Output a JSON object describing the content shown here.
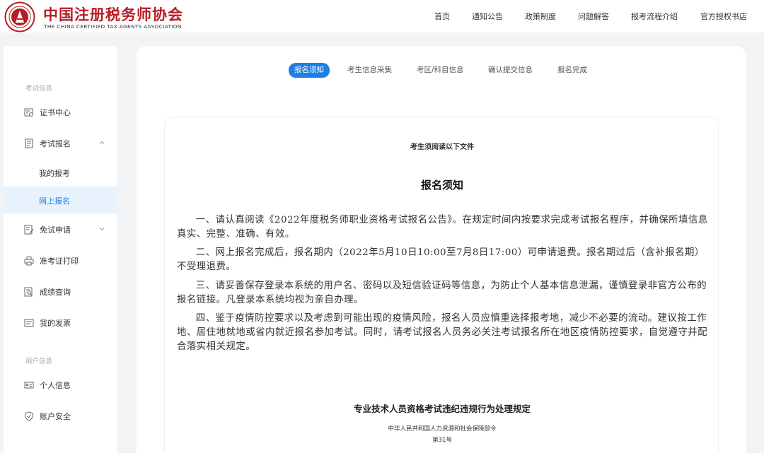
{
  "header": {
    "brand_cn": "中国注册税务师协会",
    "brand_en": "THE CHINA CERTIFIED TAX AGENTS ASSOCIATION",
    "logo_icon": "association-seal-icon",
    "brand_color": "#b71c23",
    "nav": [
      "首页",
      "通知公告",
      "政策制度",
      "问题解答",
      "报考流程介绍",
      "官方授权书店"
    ]
  },
  "sidebar": {
    "section1": "考试信息",
    "items": [
      {
        "label": "证书中心",
        "icon": "certificate-icon"
      },
      {
        "label": "考试报名",
        "icon": "document-icon"
      },
      {
        "label": "我的报考"
      },
      {
        "label": "网上报名"
      },
      {
        "label": "免试申请",
        "icon": "edit-document-icon"
      },
      {
        "label": "准考证打印",
        "icon": "printer-icon"
      },
      {
        "label": "成绩查询",
        "icon": "search-document-icon"
      },
      {
        "label": "我的发票",
        "icon": "invoice-icon"
      }
    ],
    "section2": "用户信息",
    "user_items": [
      {
        "label": "个人信息",
        "icon": "id-card-icon"
      },
      {
        "label": "账户安全",
        "icon": "shield-icon"
      }
    ]
  },
  "steps": [
    "报名须知",
    "考生信息采集",
    "考区/科目信息",
    "确认提交信息",
    "报名完成"
  ],
  "accent_color": "#1f7ee4",
  "doc": {
    "intro": "考生须阅读以下文件",
    "title": "报名须知",
    "paragraphs": [
      "一、请认真阅读《2022年度税务师职业资格考试报名公告》。在规定时间内按要求完成考试报名程序，并确保所填信息真实、完整、准确、有效。",
      "二、网上报名完成后，报名期内（2022年5月10日10:00至7月8日17:00）可申请退费。报名期过后（含补报名期）不受理退费。",
      "三、请妥善保存登录本系统的用户名、密码以及短信验证码等信息，为防止个人基本信息泄漏，谨慎登录非官方公布的报名链接。凡登录本系统均视为亲自办理。",
      "四、鉴于疫情防控要求以及考虑到可能出现的疫情风险，报名人员应慎重选择报考地，减少不必要的流动。建议按工作地、居住地就地或省内就近报名参加考试。同时，请考试报名人员务必关注考试报名所在地区疫情防控要求，自觉遵守并配合落实相关规定。"
    ],
    "regulation_title": "专业技术人员资格考试违纪违规行为处理规定",
    "regulation_issuer": "中华人民共和国人力资源和社会保障部令",
    "regulation_number": "第31号"
  }
}
